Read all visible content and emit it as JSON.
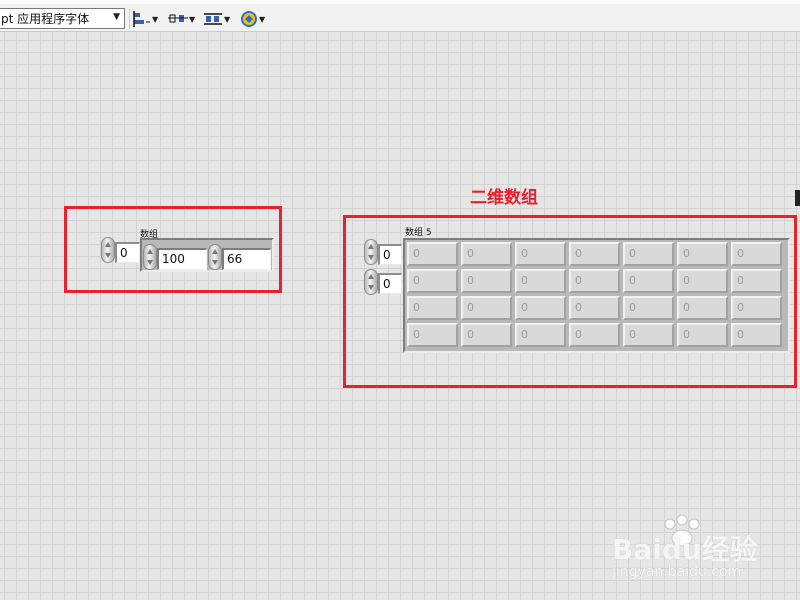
{
  "toolbar": {
    "font_selector": "pt 应用程序字体",
    "align_icon": "align-objects-icon",
    "distribute_icon": "distribute-objects-icon",
    "resize_icon": "resize-objects-icon",
    "reorder_icon": "reorder-objects-icon"
  },
  "annotation": {
    "title": "二维数组",
    "color": "#e8222b"
  },
  "array_1d": {
    "label": "数组",
    "index": "0",
    "elements": [
      "100",
      "66"
    ]
  },
  "array_2d": {
    "label": "数组 5",
    "row_index": "0",
    "col_index": "0",
    "cells": [
      [
        "0",
        "0",
        "0",
        "0",
        "0",
        "0",
        "0"
      ],
      [
        "0",
        "0",
        "0",
        "0",
        "0",
        "0",
        "0"
      ],
      [
        "0",
        "0",
        "0",
        "0",
        "0",
        "0",
        "0"
      ],
      [
        "0",
        "0",
        "0",
        "0",
        "0",
        "0",
        "0"
      ]
    ]
  },
  "watermark": {
    "logo": "Baidu经验",
    "url": "jingyan.baidu.com"
  }
}
